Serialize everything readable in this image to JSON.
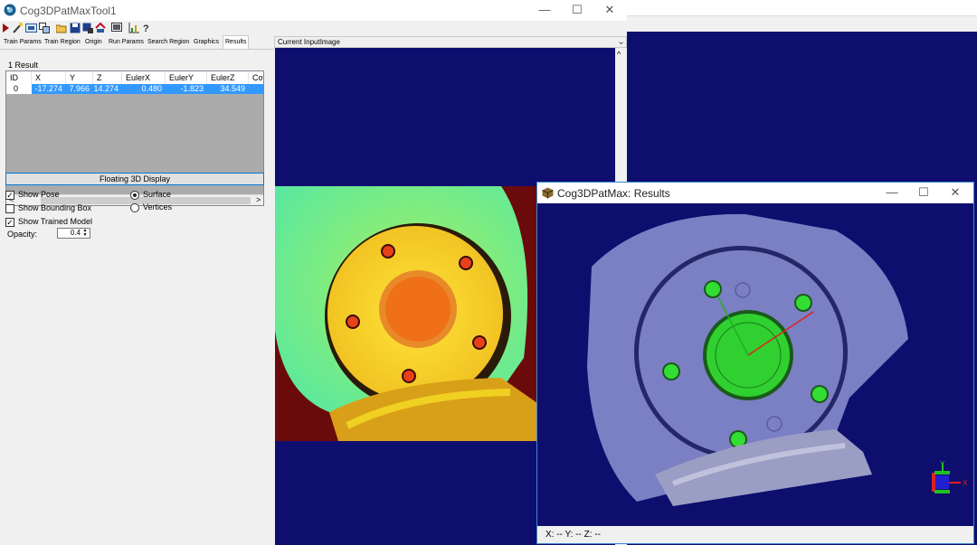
{
  "app": {
    "title": "Cog3DPatMaxTool1",
    "minimize": "—",
    "maximize": "☐",
    "close": "✕"
  },
  "toolbar": {
    "icons": [
      "run-icon",
      "wand-icon",
      "image-icon",
      "copy-icon",
      "open-icon",
      "save-icon",
      "save-as-icon",
      "reset-icon",
      "display-icon",
      "graph-icon",
      "help-icon"
    ]
  },
  "tabs": [
    "Train Params",
    "Train Region",
    "Origin",
    "Run Params",
    "Search Region",
    "Graphics",
    "Results"
  ],
  "active_tab": "Results",
  "results": {
    "count_label": "1 Result",
    "columns": [
      "ID",
      "X",
      "Y",
      "Z",
      "EulerX",
      "EulerY",
      "EulerZ",
      "Cov"
    ],
    "rows": [
      {
        "id": "0",
        "x": "-17.274",
        "y": "7.966",
        "z": "14.274",
        "eulerx": "0.480",
        "eulery": "-1.823",
        "eulerz": "34.549",
        "cov": ""
      }
    ],
    "scroll_left": "<",
    "scroll_right": ">"
  },
  "display": {
    "floating_button": "Floating 3D Display",
    "show_pose": "Show Pose",
    "show_bounding_box": "Show Bounding Box",
    "show_trained_model": "Show Trained Model",
    "surface": "Surface",
    "vertices": "Vertices",
    "opacity_label": "Opacity:",
    "opacity_value": "0.4",
    "checks": {
      "show_pose": true,
      "show_bounding_box": false,
      "show_trained_model": true
    },
    "mode": "Surface"
  },
  "viewer": {
    "title": "Current InputImage",
    "dropdown": "⌄",
    "scroll_up": "^"
  },
  "results_window": {
    "title": "Cog3DPatMax: Results",
    "minimize": "—",
    "maximize": "☐",
    "close": "✕",
    "status": "X: --  Y: --  Z: --",
    "axis_y": "Y",
    "axis_x": "X"
  },
  "colors": {
    "canvas_bg": "#0e0e6e",
    "selection": "#3399ff",
    "window_border": "#3c8ad6",
    "point_cloud": "#7b7fc4",
    "model_match": "#33dd33"
  }
}
